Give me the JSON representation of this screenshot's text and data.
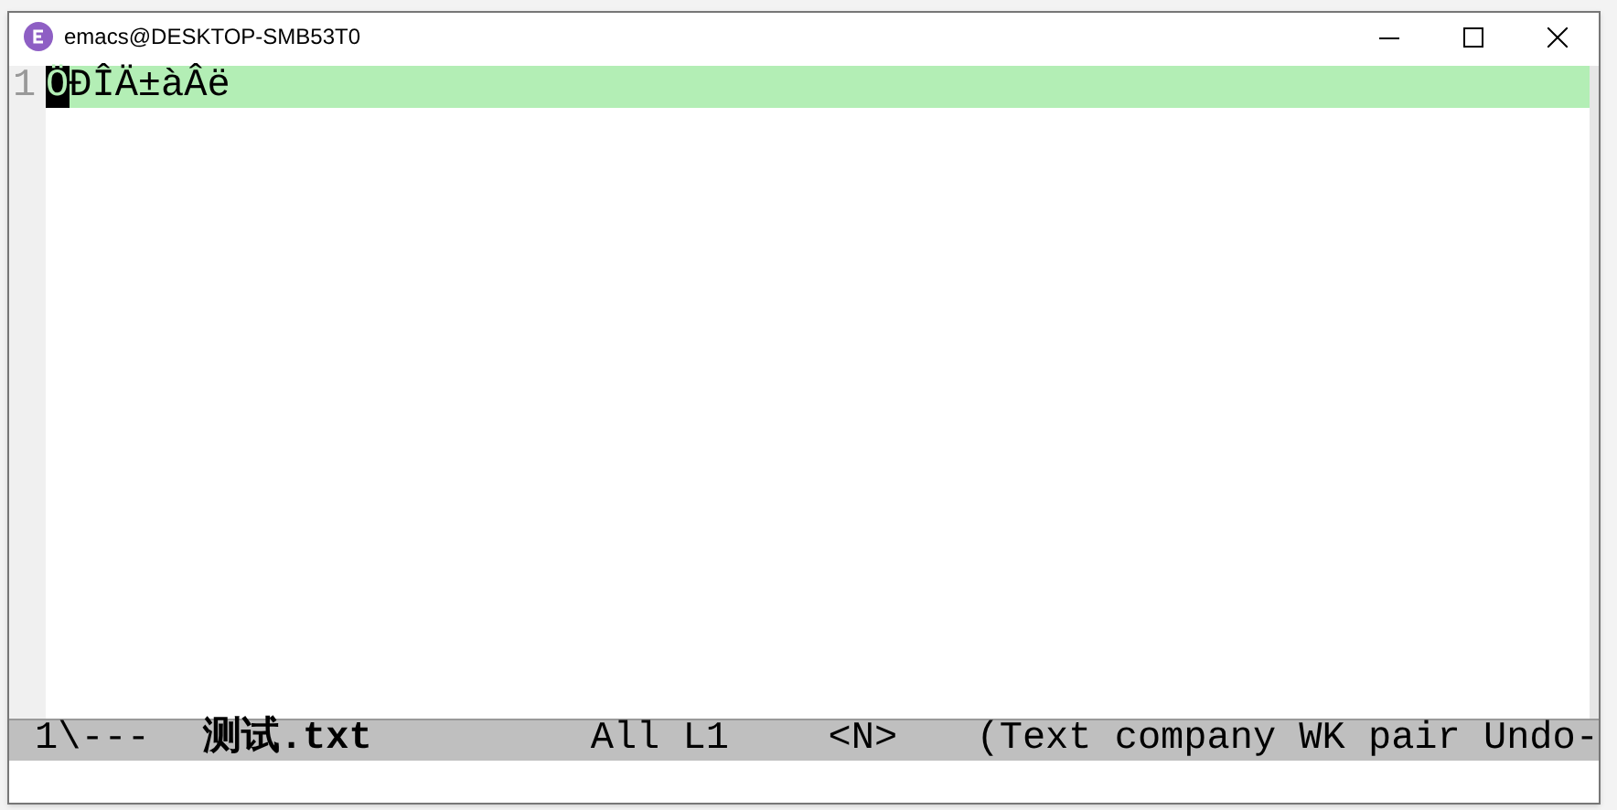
{
  "window": {
    "title": "emacs@DESKTOP-SMB53T0"
  },
  "buffer": {
    "lines": [
      {
        "number": "1",
        "current": true,
        "cursor_char": "Ö",
        "text": "ÐÎÄ±àÂë"
      }
    ]
  },
  "mode_line": {
    "status": "1\\---",
    "buffer_name": "测试.txt",
    "position": "All L1",
    "input_method": "<N>",
    "modes": "(Text company WK pair Undo-"
  }
}
